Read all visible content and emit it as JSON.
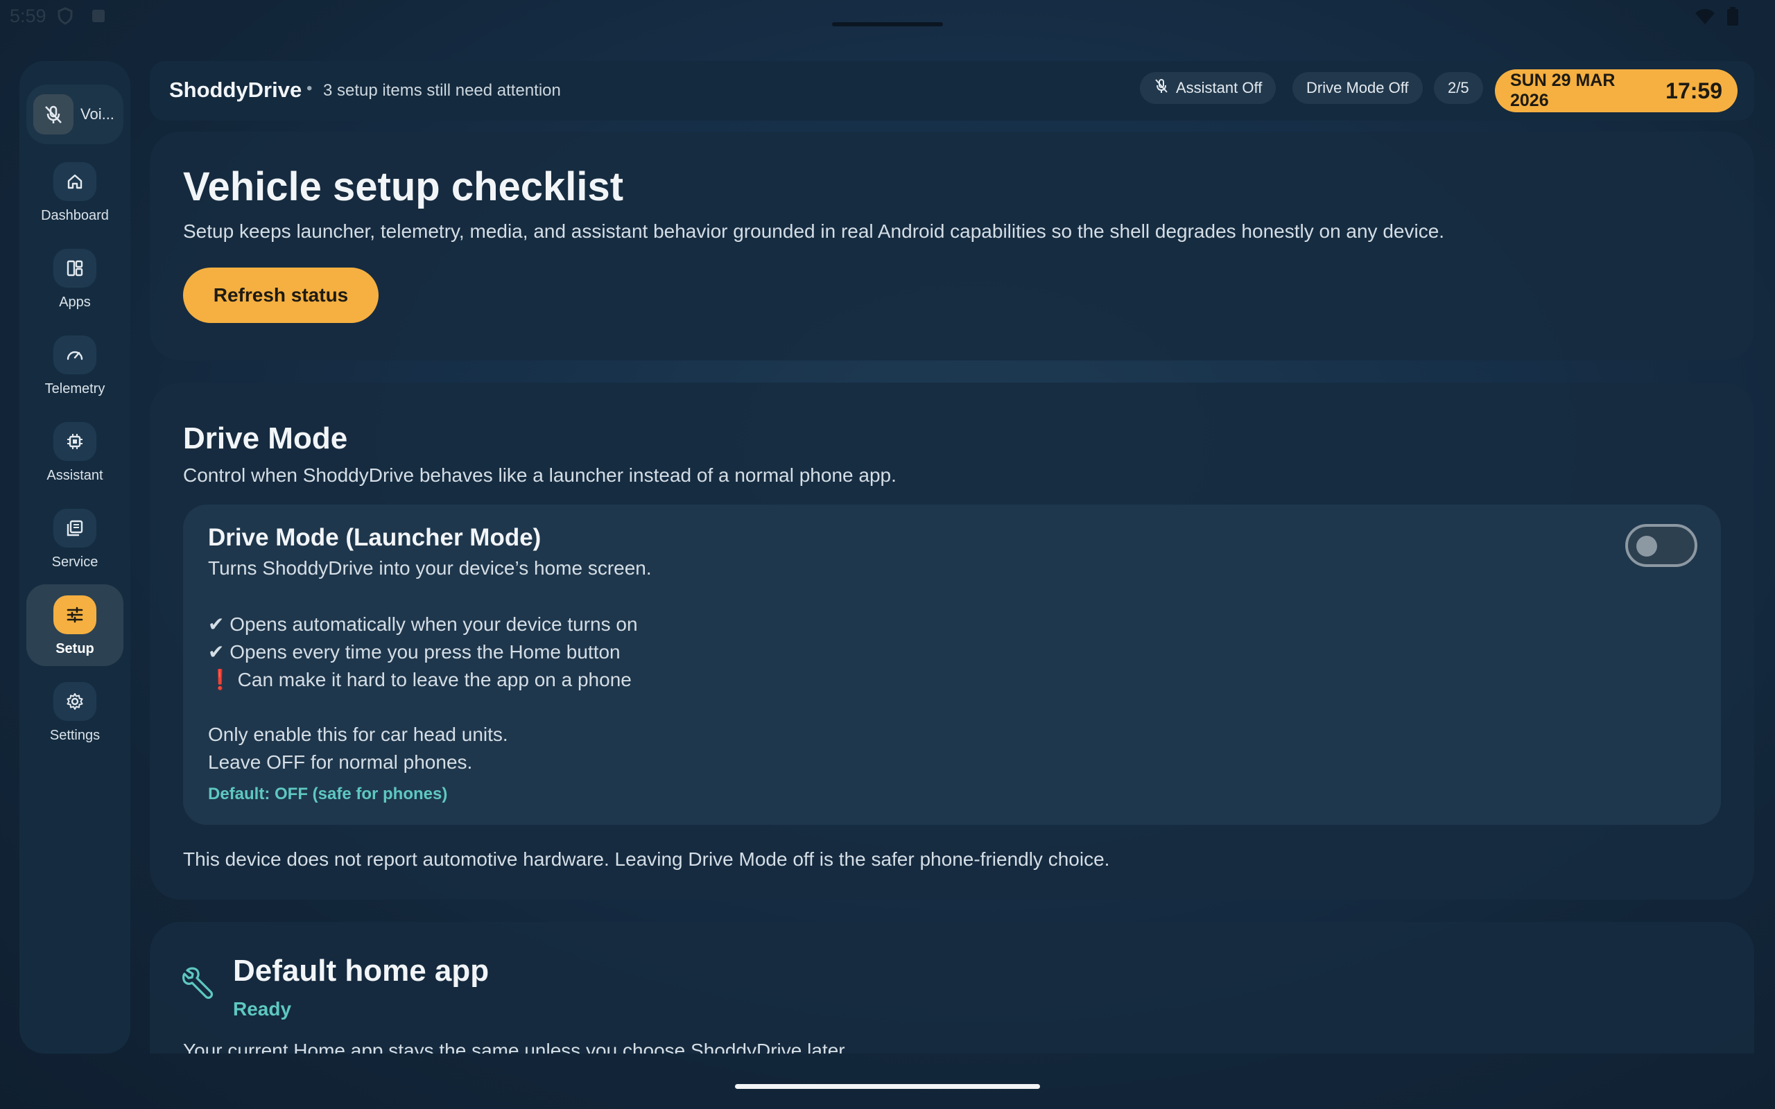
{
  "status_bar": {
    "time": "5:59"
  },
  "sidebar": {
    "voice_label": "Voi...",
    "items": [
      {
        "label": "Dashboard",
        "icon": "home-icon"
      },
      {
        "label": "Apps",
        "icon": "apps-icon"
      },
      {
        "label": "Telemetry",
        "icon": "speedometer-icon"
      },
      {
        "label": "Assistant",
        "icon": "chip-icon"
      },
      {
        "label": "Service",
        "icon": "service-icon"
      },
      {
        "label": "Setup",
        "icon": "tune-icon",
        "active": true
      },
      {
        "label": "Settings",
        "icon": "gear-icon"
      }
    ]
  },
  "topbar": {
    "title": "ShoddyDrive",
    "separator": "•",
    "subtitle": "3 setup items still need attention",
    "assistant_pill": "Assistant Off",
    "drive_mode_pill": "Drive Mode Off",
    "progress_pill": "2/5",
    "date": "SUN 29 MAR 2026",
    "time": "17:59"
  },
  "checklist": {
    "title": "Vehicle setup checklist",
    "description": "Setup keeps launcher, telemetry, media, and assistant behavior grounded in real Android capabilities so the shell degrades honestly on any device.",
    "refresh_label": "Refresh status"
  },
  "drive_mode": {
    "title": "Drive Mode",
    "description": "Control when ShoddyDrive behaves like a launcher instead of a normal phone app.",
    "option_title": "Drive Mode (Launcher Mode)",
    "option_summary": "Turns ShoddyDrive into your device’s home screen.",
    "bullet1": "✔ Opens automatically when your device turns on",
    "bullet2": "✔ Opens every time you press the Home button",
    "bullet3_mark": "❗",
    "bullet3_text": "Can make it hard to leave the app on a phone",
    "note1": "Only enable this for car head units.",
    "note2": "Leave OFF for normal phones.",
    "default_text": "Default: OFF (safe for phones)",
    "toggle_on": false,
    "footer": "This device does not report automotive hardware. Leaving Drive Mode off is the safer phone-friendly choice."
  },
  "home_app": {
    "title": "Default home app",
    "status": "Ready",
    "description": "Your current Home app stays the same unless you choose ShoddyDrive later."
  },
  "colors": {
    "accent": "#f5b041",
    "teal": "#5ec8c1",
    "background": "#17304a"
  }
}
